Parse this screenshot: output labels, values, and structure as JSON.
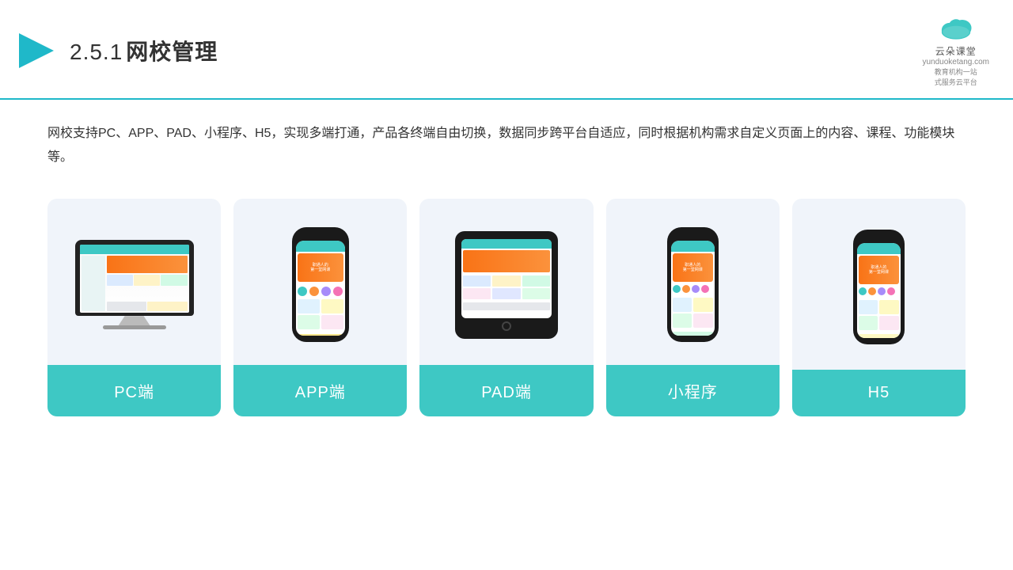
{
  "header": {
    "section_number": "2.5.1",
    "title": "网校管理",
    "logo_name": "云朵课堂",
    "logo_url": "yunduoketang.com",
    "logo_tagline": "教育机构一站\n式服务云平台"
  },
  "description": "网校支持PC、APP、PAD、小程序、H5，实现多端打通，产品各终端自由切换，数据同步跨平台自适应，同时根据机构需求自定义页面上的内容、课程、功能模块等。",
  "cards": [
    {
      "id": "pc",
      "label": "PC端"
    },
    {
      "id": "app",
      "label": "APP端"
    },
    {
      "id": "pad",
      "label": "PAD端"
    },
    {
      "id": "mini-program",
      "label": "小程序"
    },
    {
      "id": "h5",
      "label": "H5"
    }
  ],
  "accent_color": "#3ec8c4",
  "bg_color": "#f0f4fa"
}
